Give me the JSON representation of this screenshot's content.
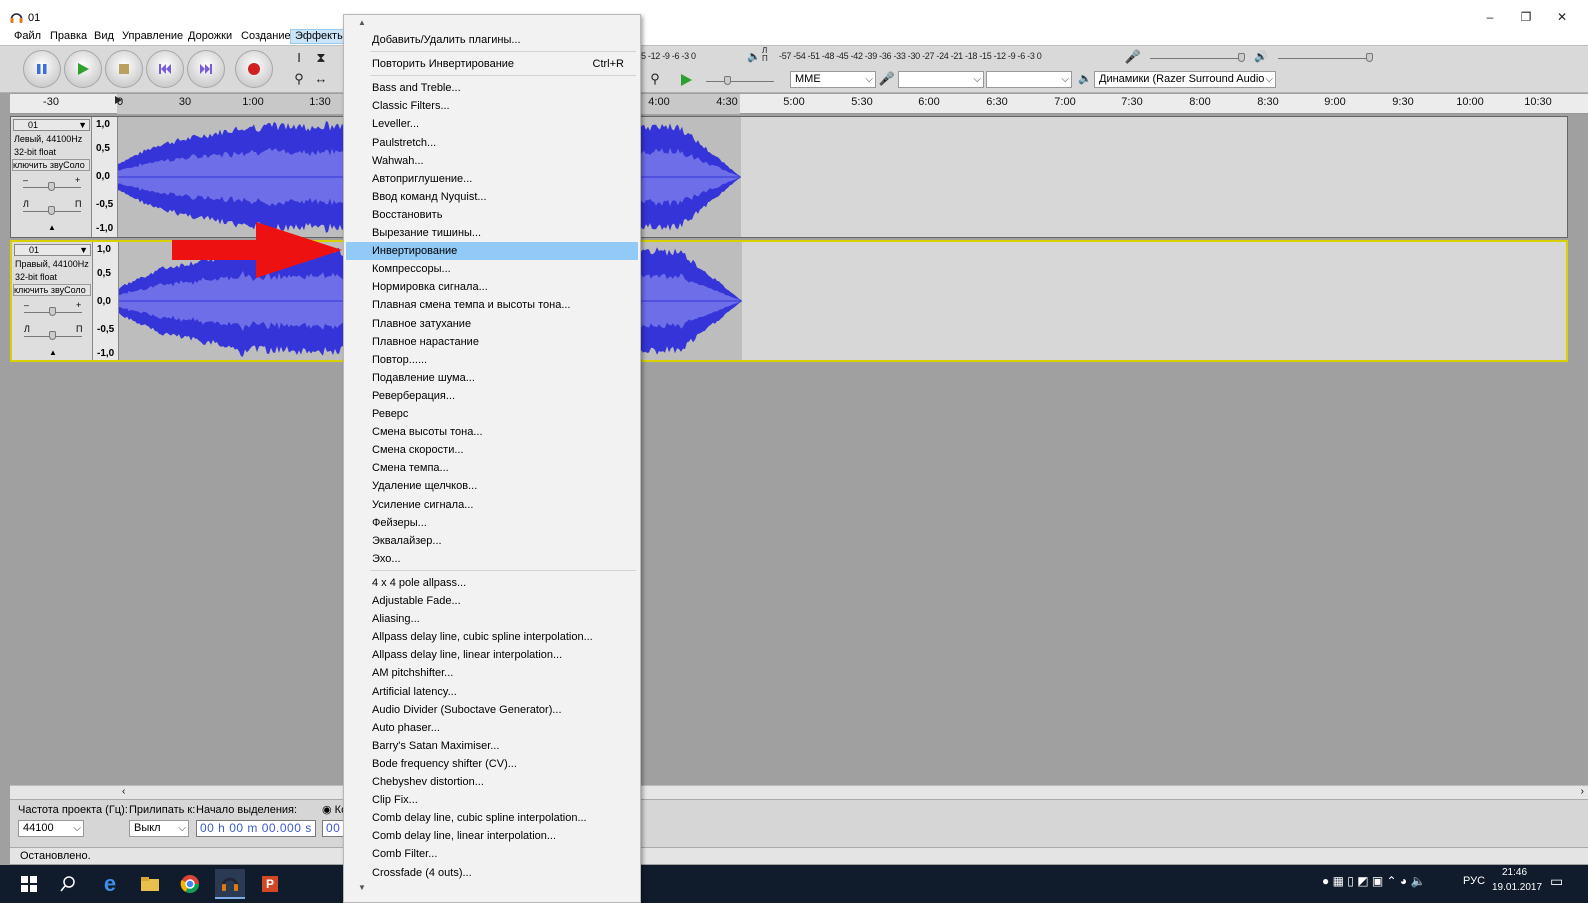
{
  "window": {
    "title": "01",
    "min": "–",
    "max": "❐",
    "close": "✕"
  },
  "menubar": [
    "Файл",
    "Правка",
    "Вид",
    "Управление",
    "Дорожки",
    "Создание",
    "Эффекты"
  ],
  "meters": {
    "rec_scale": "-57 -54 -51 -48 -45 -42 -39 -36 -33 -30 -27 -24 -21 -18 -15 -12  -9  -6  -3  0",
    "play_scale_visible": "5 -12  -9  -6  -3  0",
    "lp_top": "Л",
    "lp_bottom": "П"
  },
  "device": {
    "host": "MME",
    "output": "Динамики (Razer Surround Audio"
  },
  "ruler": [
    "-30",
    "0",
    "30",
    "1:00",
    "1:30",
    "4:00",
    "4:30",
    "5:00",
    "5:30",
    "6:00",
    "6:30",
    "7:00",
    "7:30",
    "8:00",
    "8:30",
    "9:00",
    "9:30",
    "10:00",
    "10:30"
  ],
  "tracks": [
    {
      "name": "01",
      "line1": "Левый, 44100Hz",
      "line2": "32-bit float",
      "buttons": "ключить звуСоло",
      "gain_minus": "–",
      "gain_plus": "+",
      "pan_l": "Л",
      "pan_r": "П",
      "collapse": "▲",
      "scale": [
        "1,0",
        "0,5",
        "0,0",
        "-0,5",
        "-1,0"
      ]
    },
    {
      "name": "01",
      "line1": "Правый, 44100Hz",
      "line2": "32-bit float",
      "buttons": "ключить звуСоло",
      "gain_minus": "–",
      "gain_plus": "+",
      "pan_l": "Л",
      "pan_r": "П",
      "collapse": "▲",
      "scale": [
        "1,0",
        "0,5",
        "0,0",
        "-0,5",
        "-1,0"
      ]
    }
  ],
  "selection_bar": {
    "rate_label": "Частота проекта (Гц):",
    "rate_value": "44100",
    "snap_label": "Прилипать к:",
    "snap_value": "Выкл",
    "start_label": "Начало выделения:",
    "start_value": "00 h 00 m 00.000 s",
    "radio_label": "Ко",
    "end_value_visible": "00"
  },
  "status": "Остановлено.",
  "taskbar": {
    "lang": "РУС",
    "time": "21:46",
    "date": "19.01.2017"
  },
  "dropdown": {
    "top_arrow": "▲",
    "bottom_arrow": "▼",
    "items": [
      {
        "label": "Добавить/Удалить плагины...",
        "shortcut": ""
      },
      {
        "label": "Повторить Инвертирование",
        "shortcut": "Ctrl+R"
      },
      {
        "label": "Bass and Treble...",
        "shortcut": ""
      },
      {
        "label": "Classic Filters...",
        "shortcut": ""
      },
      {
        "label": "Leveller...",
        "shortcut": ""
      },
      {
        "label": "Paulstretch...",
        "shortcut": ""
      },
      {
        "label": "Wahwah...",
        "shortcut": ""
      },
      {
        "label": "Автоприглушение...",
        "shortcut": ""
      },
      {
        "label": "Ввод команд Nyquist...",
        "shortcut": ""
      },
      {
        "label": "Восстановить",
        "shortcut": ""
      },
      {
        "label": "Вырезание тишины...",
        "shortcut": ""
      },
      {
        "label": "Инвертирование",
        "shortcut": ""
      },
      {
        "label": "Компрессоры...",
        "shortcut": ""
      },
      {
        "label": "Нормировка сигнала...",
        "shortcut": ""
      },
      {
        "label": "Плавная смена темпа и высоты тона...",
        "shortcut": ""
      },
      {
        "label": "Плавное затухание",
        "shortcut": ""
      },
      {
        "label": "Плавное нарастание",
        "shortcut": ""
      },
      {
        "label": "Повтор......",
        "shortcut": ""
      },
      {
        "label": "Подавление шума...",
        "shortcut": ""
      },
      {
        "label": "Реверберация...",
        "shortcut": ""
      },
      {
        "label": "Реверс",
        "shortcut": ""
      },
      {
        "label": "Смена высоты тона...",
        "shortcut": ""
      },
      {
        "label": "Смена скорости...",
        "shortcut": ""
      },
      {
        "label": "Смена темпа...",
        "shortcut": ""
      },
      {
        "label": "Удаление щелчков...",
        "shortcut": ""
      },
      {
        "label": "Усиление сигнала...",
        "shortcut": ""
      },
      {
        "label": "Фейзеры...",
        "shortcut": ""
      },
      {
        "label": "Эквалайзер...",
        "shortcut": ""
      },
      {
        "label": "Эхо...",
        "shortcut": ""
      },
      {
        "label": "4 x 4 pole allpass...",
        "shortcut": ""
      },
      {
        "label": "Adjustable Fade...",
        "shortcut": ""
      },
      {
        "label": "Aliasing...",
        "shortcut": ""
      },
      {
        "label": "Allpass delay line, cubic spline interpolation...",
        "shortcut": ""
      },
      {
        "label": "Allpass delay line, linear interpolation...",
        "shortcut": ""
      },
      {
        "label": "AM pitchshifter...",
        "shortcut": ""
      },
      {
        "label": "Artificial latency...",
        "shortcut": ""
      },
      {
        "label": "Audio Divider (Suboctave Generator)...",
        "shortcut": ""
      },
      {
        "label": "Auto phaser...",
        "shortcut": ""
      },
      {
        "label": "Barry's Satan Maximiser...",
        "shortcut": ""
      },
      {
        "label": "Bode frequency shifter (CV)...",
        "shortcut": ""
      },
      {
        "label": "Chebyshev distortion...",
        "shortcut": ""
      },
      {
        "label": "Clip Fix...",
        "shortcut": ""
      },
      {
        "label": "Comb delay line, cubic spline interpolation...",
        "shortcut": ""
      },
      {
        "label": "Comb delay line, linear interpolation...",
        "shortcut": ""
      },
      {
        "label": "Comb Filter...",
        "shortcut": ""
      },
      {
        "label": "Crossfade (4 outs)...",
        "shortcut": ""
      }
    ]
  },
  "colors": {
    "wave": "#3434d8",
    "wave_rms": "#6e6ee8",
    "highlight": "#91c9f7",
    "track_select": "#d8d000",
    "arrow": "#ee1111"
  }
}
